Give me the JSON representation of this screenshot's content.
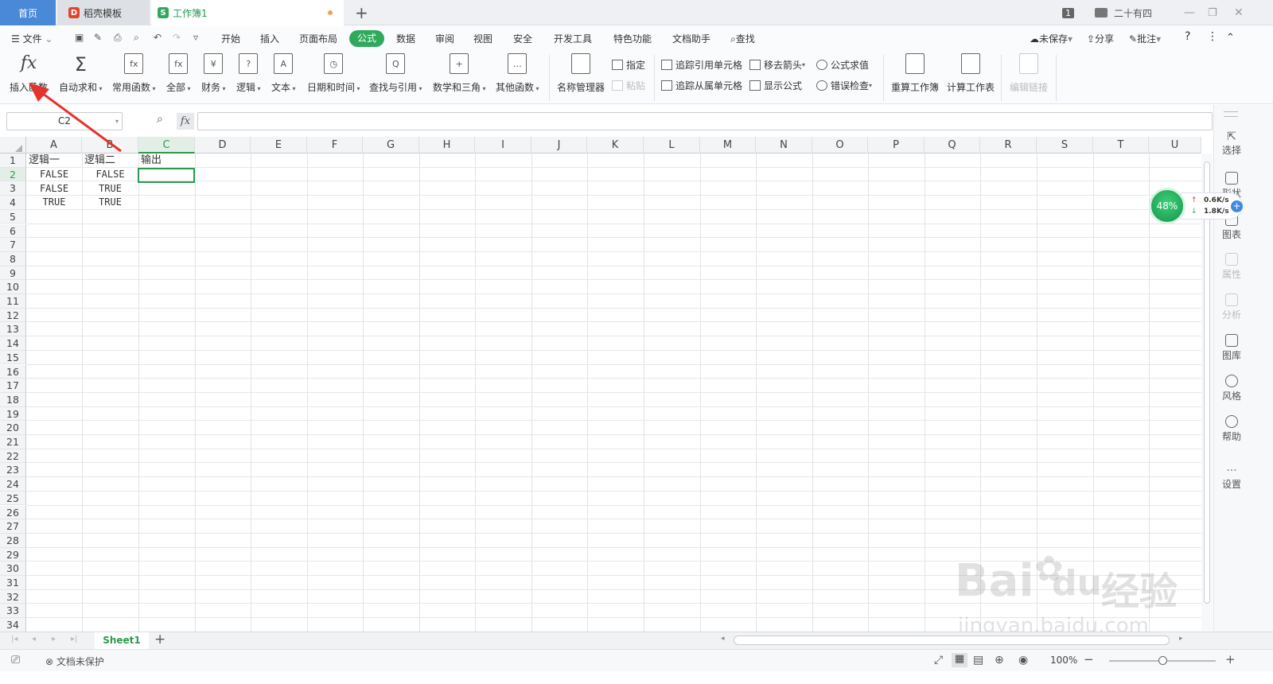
{
  "titlebar": {
    "tabs": [
      {
        "label": "首页"
      },
      {
        "label": "稻壳模板"
      },
      {
        "label": "工作簿1"
      }
    ],
    "page_count": "1",
    "user": "二十有四"
  },
  "menu": {
    "items": [
      "文件",
      "开始",
      "插入",
      "页面布局",
      "公式",
      "数据",
      "审阅",
      "视图",
      "安全",
      "开发工具",
      "特色功能",
      "文档助手",
      "查找"
    ],
    "right": {
      "unsaved": "未保存",
      "share": "分享",
      "comment": "批注"
    }
  },
  "ribbon": {
    "big": [
      {
        "label": "插入函数",
        "icon": "fx"
      },
      {
        "label": "自动求和",
        "icon": "Σ"
      },
      {
        "label": "常用函数",
        "icon": "fx"
      },
      {
        "label": "全部",
        "icon": "fx"
      },
      {
        "label": "财务",
        "icon": "¥"
      },
      {
        "label": "逻辑",
        "icon": "?"
      },
      {
        "label": "文本",
        "icon": "A"
      },
      {
        "label": "日期和时间",
        "icon": "◷"
      },
      {
        "label": "查找与引用",
        "icon": "Q"
      },
      {
        "label": "数学和三角",
        "icon": "+"
      },
      {
        "label": "其他函数",
        "icon": "…"
      },
      {
        "label": "名称管理器",
        "icon": ""
      },
      {
        "label": "重算工作簿",
        "icon": ""
      },
      {
        "label": "计算工作表",
        "icon": ""
      },
      {
        "label": "编辑链接",
        "icon": ""
      }
    ],
    "small": {
      "assign": "指定",
      "paste": "粘贴",
      "trace_precedents": "追踪引用单元格",
      "trace_dependents": "追踪从属单元格",
      "remove_arrows": "移去箭头",
      "show_formulas": "显示公式",
      "evaluate": "公式求值",
      "error_check": "错误检查"
    }
  },
  "formula_bar": {
    "name_box": "C2",
    "fx": "fx",
    "value": ""
  },
  "sheet": {
    "columns": [
      "A",
      "B",
      "C",
      "D",
      "E",
      "F",
      "G",
      "H",
      "I",
      "J",
      "K",
      "L",
      "M",
      "N",
      "O",
      "P",
      "Q",
      "R",
      "S",
      "T",
      "U"
    ],
    "rows": [
      "1",
      "2",
      "3",
      "4",
      "5",
      "6",
      "7",
      "8",
      "9",
      "10",
      "11",
      "12",
      "13",
      "14",
      "15",
      "16",
      "17",
      "18",
      "19",
      "20",
      "21",
      "22",
      "23",
      "24",
      "25",
      "26",
      "27",
      "28",
      "29",
      "30",
      "31",
      "32",
      "33",
      "34"
    ],
    "cells": {
      "A1": "逻辑一",
      "B1": "逻辑二",
      "C1": "输出",
      "A2": "FALSE",
      "B2": "FALSE",
      "A3": "FALSE",
      "B3": "TRUE",
      "A4": "TRUE",
      "B4": "TRUE"
    },
    "tab": "Sheet1"
  },
  "sidebar": {
    "items": [
      "选择",
      "形状",
      "图表",
      "属性",
      "分析",
      "图库",
      "风格",
      "帮助",
      "设置"
    ]
  },
  "speed": {
    "percent": "48%",
    "up": "0.6K/s",
    "down": "1.8K/s"
  },
  "status": {
    "protect": "文档未保护",
    "zoom": "100%"
  },
  "watermark": {
    "brand": "Bai",
    "brand2": "du",
    "cn": "经验",
    "url": "jingyan.baidu.com"
  },
  "colors": {
    "accent": "#2faa5d",
    "home_tab": "#4a88d8",
    "selection": "#2c9a4e",
    "arrow": "#e5322d"
  }
}
